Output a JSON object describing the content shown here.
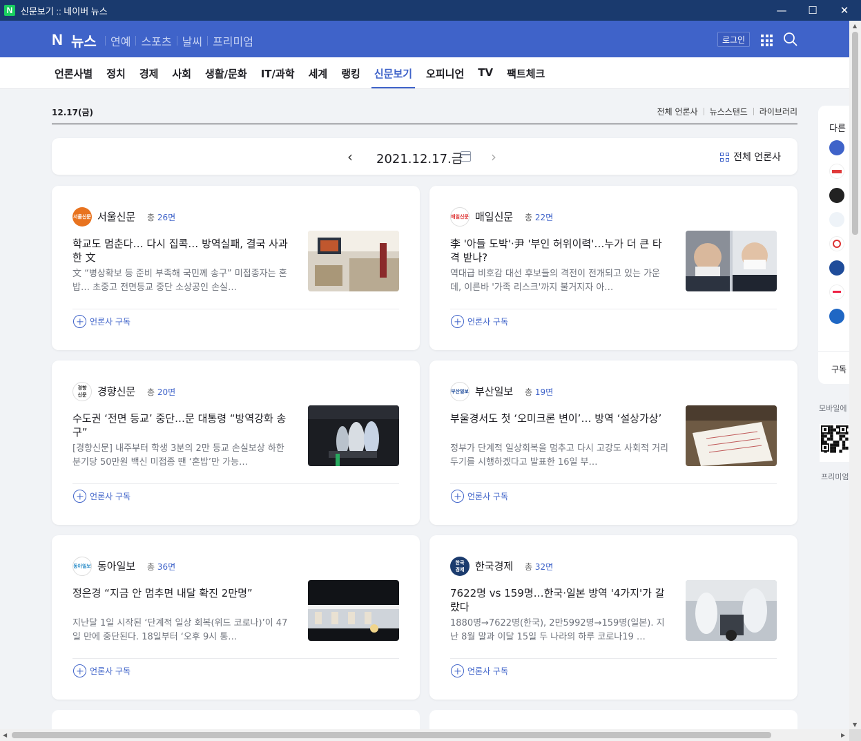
{
  "window": {
    "title": "신문보기 :: 네이버 뉴스",
    "app_icon": "N",
    "minimize": "—",
    "maximize": "☐",
    "close": "✕"
  },
  "header": {
    "logo_n": "N",
    "logo_news": "뉴스",
    "topnav": [
      "연예",
      "스포츠",
      "날씨",
      "프리미엄"
    ],
    "login": "로그인"
  },
  "categories": [
    "언론사별",
    "정치",
    "경제",
    "사회",
    "생활/문화",
    "IT/과학",
    "세계",
    "랭킹",
    "신문보기",
    "오피니언",
    "TV",
    "팩트체크"
  ],
  "active_category": "신문보기",
  "date_row": {
    "short": "12.17(금)",
    "links": [
      "전체 언론사",
      "뉴스스탠드",
      "라이브러리"
    ]
  },
  "date_nav": {
    "prev": "‹",
    "date": "2021.12.17.금",
    "next": "›",
    "all_press": "전체 언론사"
  },
  "cards": [
    {
      "press": "서울신문",
      "logo_text": "서울신문",
      "pages_prefix": "총",
      "pages": "26면",
      "headline": "학교도 멈춘다… 다시 집콕… 방역실패, 결국 사과한 文",
      "summary": "文 “병상확보 등 준비 부족해 국민께 송구” 미접종자는 혼밥… 초중고 전면등교 중단 소상공인 손실…",
      "subscribe": "언론사 구독"
    },
    {
      "press": "매일신문",
      "logo_text": "매일신문",
      "pages_prefix": "총",
      "pages": "22면",
      "headline": "李 '아들 도박'·尹 '부인 허위이력'…누가 더 큰 타격 받나?",
      "summary": "역대급 비호감 대선 후보들의 격전이 전개되고 있는 가운데, 이른바 '가족 리스크'까지 불거지자 아…",
      "subscribe": "언론사 구독"
    },
    {
      "press": "경향신문",
      "logo_text": "경향\n신문",
      "pages_prefix": "총",
      "pages": "20면",
      "headline": "수도권 ‘전면 등교’ 중단…문 대통령 “방역강화 송구”",
      "summary": "[경향신문] 내주부터 학생 3분의 2만 등교 손실보상 하한 분기당 50만원 백신 미접종 땐 ‘혼밥’만 가능…",
      "subscribe": "언론사 구독"
    },
    {
      "press": "부산일보",
      "logo_text": "부산일보",
      "pages_prefix": "총",
      "pages": "19면",
      "headline": "부울경서도 첫 ‘오미크론 변이’… 방역 ‘설상가상’",
      "summary": "정부가 단계적 일상회복을 멈추고 다시 고강도 사회적 거리 두기를 시행하겠다고 발표한 16일 부…",
      "subscribe": "언론사 구독"
    },
    {
      "press": "동아일보",
      "logo_text": "동아일보",
      "pages_prefix": "총",
      "pages": "36면",
      "headline": "정은경 “지금 안 멈추면 내달 확진 2만명”",
      "summary": "지난달 1일 시작된 ‘단계적 일상 회복(위드 코로나)’이 47일 만에 중단된다. 18일부터 ‘오후 9시 통…",
      "subscribe": "언론사 구독"
    },
    {
      "press": "한국경제",
      "logo_text": "한국\n경제",
      "pages_prefix": "총",
      "pages": "32면",
      "headline": "7622명 vs 159명…한국·일본 방역 '4가지'가 갈랐다",
      "summary": "1880명→7622명(한국), 2만5992명→159명(일본). 지난 8월 말과 이달 15일 두 나라의 하루 코로나19 …",
      "subscribe": "언론사 구독"
    }
  ],
  "rail": {
    "label": "다른",
    "subscribe": "구독"
  },
  "mobile": {
    "label": "모바일에",
    "premium": "프리미엄"
  },
  "colors": {
    "brand": "#3f63c9",
    "titlebar": "#1a3a6e",
    "background": "#f1f3f6"
  }
}
